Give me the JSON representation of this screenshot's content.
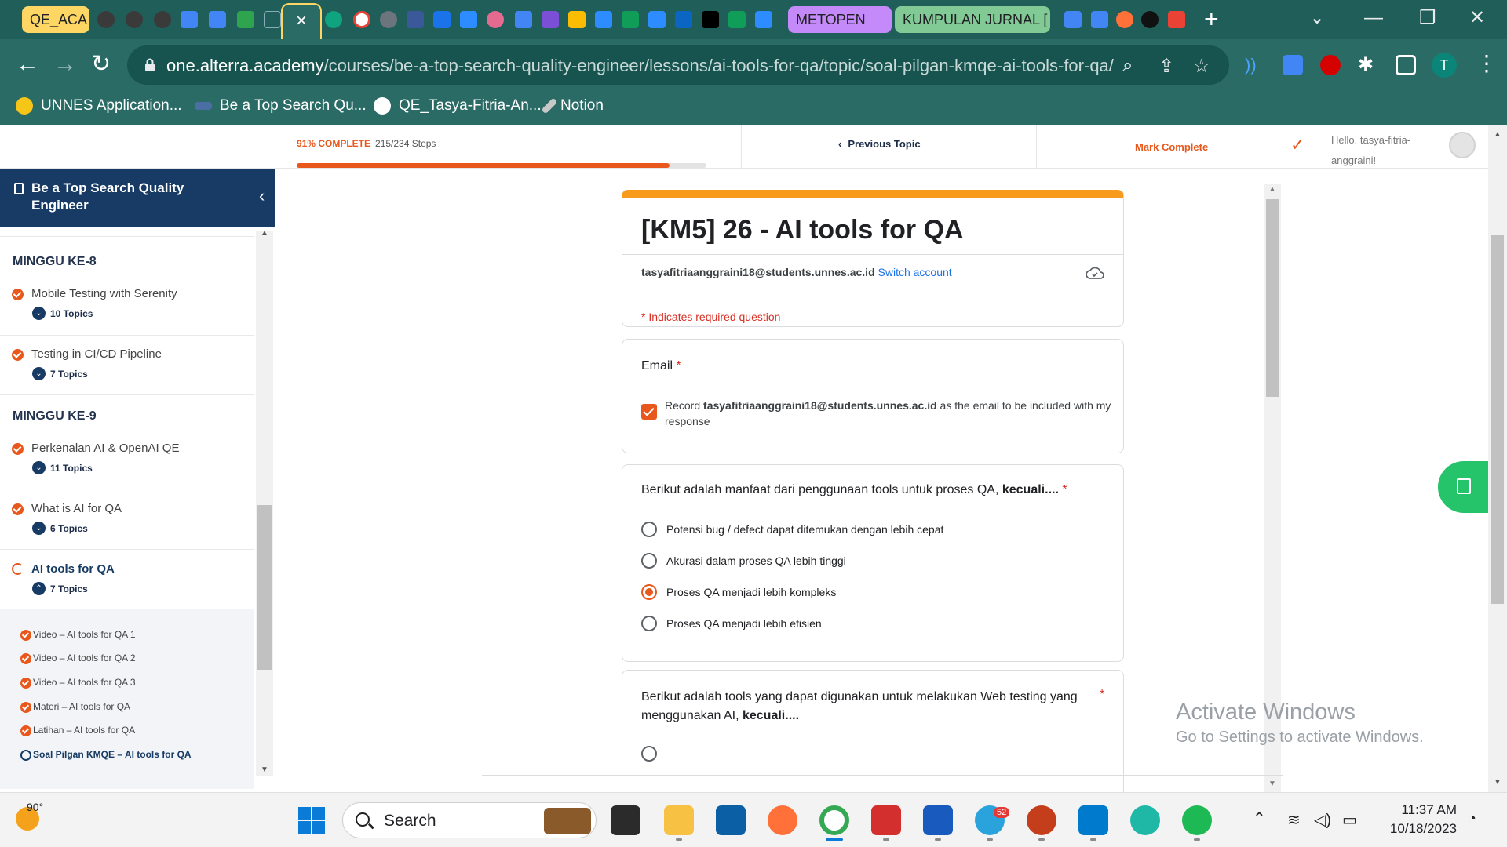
{
  "browser": {
    "tab_groups": [
      {
        "label": "QE_ACA",
        "color": "#fdd663"
      },
      {
        "label": "METOPEN",
        "color": "#c58af9"
      },
      {
        "label": "KUMPULAN JURNAL [",
        "color": "#81c995"
      }
    ],
    "active_tab_glyph": "×",
    "new_tab_glyph": "+",
    "url_host": "one.alterra.academy",
    "url_path": "/courses/be-a-top-search-quality-engineer/lessons/ai-tools-for-qa/topic/soal-pilgan-kmqe-ai-tools-for-qa/",
    "profile_initial": "T",
    "bookmarks": [
      {
        "label": "UNNES Application...",
        "icon": "unnes-icon"
      },
      {
        "label": "Be a Top Search Qu...",
        "icon": "alterra-icon"
      },
      {
        "label": "QE_Tasya-Fitria-An...",
        "icon": "github-icon"
      },
      {
        "label": "Notion",
        "icon": "notion-icon"
      }
    ]
  },
  "page_header": {
    "progress_label": "91% COMPLETE",
    "progress_steps": "215/234 Steps",
    "progress_fraction": 0.91,
    "previous_topic": "Previous Topic",
    "mark_complete": "Mark Complete",
    "greeting": "Hello, tasya-fitria-anggraini!"
  },
  "sidebar": {
    "course_title": "Be a Top Search Quality Engineer",
    "weeks": [
      {
        "title": "MINGGU KE-8",
        "lessons": [
          {
            "title": "Mobile Testing with Serenity",
            "count": "10 Topics"
          },
          {
            "title": "Testing in CI/CD Pipeline",
            "count": "7 Topics"
          }
        ]
      },
      {
        "title": "MINGGU KE-9",
        "lessons": [
          {
            "title": "Perkenalan AI & OpenAI QE",
            "count": "11 Topics"
          },
          {
            "title": "What is AI for QA",
            "count": "6 Topics"
          },
          {
            "title": "AI tools for QA",
            "count": "7 Topics"
          }
        ]
      }
    ],
    "topics": [
      "Video – AI tools for QA 1",
      "Video – AI tools for QA 2",
      "Video – AI tools for QA 3",
      "Materi – AI tools for QA",
      "Latihan – AI tools for QA",
      "Soal Pilgan KMQE – AI tools for QA"
    ]
  },
  "form": {
    "title": "[KM5] 26 - AI tools for QA",
    "account_email": "tasyafitriaanggraini18@students.unnes.ac.id",
    "switch_account": "Switch account",
    "required_note": "* Indicates required question",
    "email_question": {
      "label": "Email",
      "required_mark": "*",
      "record_prefix": "Record ",
      "record_email": "tasyafitriaanggraini18@students.unnes.ac.id",
      "record_suffix": " as the email to be included with my response",
      "checked": true
    },
    "question1": {
      "text": "Berikut adalah manfaat dari penggunaan tools untuk proses QA, ",
      "emphasis": "kecuali....",
      "required_mark": "*",
      "options": [
        "Potensi bug / defect dapat ditemukan dengan lebih cepat",
        "Akurasi dalam proses QA lebih tinggi",
        "Proses QA menjadi lebih kompleks",
        "Proses QA menjadi lebih efisien"
      ],
      "selected_index": 2
    },
    "question2": {
      "text": "Berikut adalah tools yang dapat digunakan untuk melakukan Web testing yang menggunakan AI, ",
      "emphasis": "kecuali....",
      "required_mark": "*"
    }
  },
  "watermark": {
    "title": "Activate Windows",
    "subtitle": "Go to Settings to activate Windows."
  },
  "taskbar": {
    "temperature": "90°",
    "search_placeholder": "Search",
    "time": "11:37 AM",
    "date": "10/18/2023",
    "telegram_badge": "52"
  }
}
